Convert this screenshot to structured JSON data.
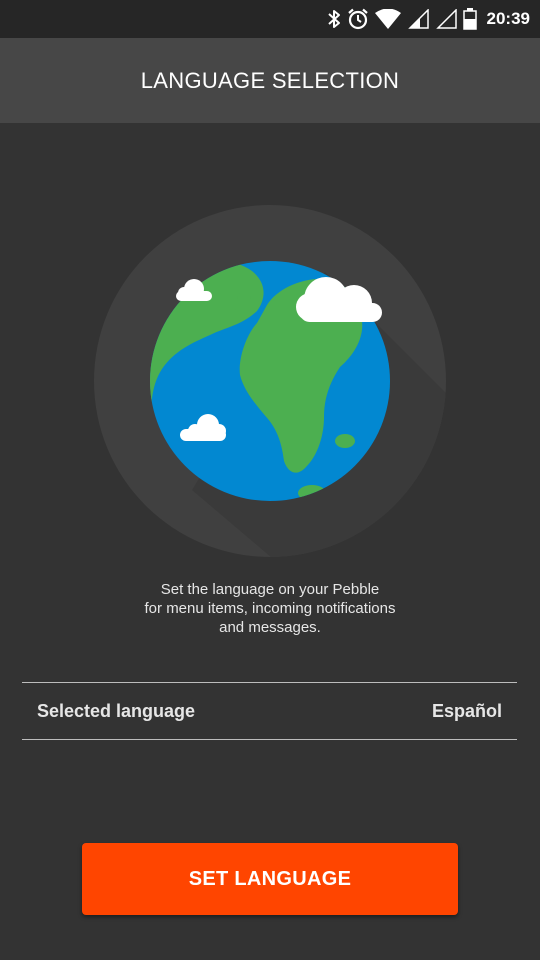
{
  "status_bar": {
    "time": "20:39",
    "icons": [
      "bluetooth-icon",
      "alarm-icon",
      "wifi-icon",
      "signal-icon",
      "signal-icon",
      "battery-icon"
    ]
  },
  "toolbar": {
    "title": "LANGUAGE SELECTION"
  },
  "illustration": {
    "icon": "globe-icon"
  },
  "description": {
    "line1": "Set the language on your Pebble",
    "line2": "for menu items, incoming notifications",
    "line3": "and messages."
  },
  "language_row": {
    "label": "Selected language",
    "value": "Español"
  },
  "primary_button": {
    "label": "SET LANGUAGE"
  },
  "colors": {
    "background": "#333333",
    "toolbar": "#474747",
    "status_bar": "#262626",
    "accent": "#ff4500",
    "ocean": "#0288d1",
    "land": "#4caf50"
  }
}
